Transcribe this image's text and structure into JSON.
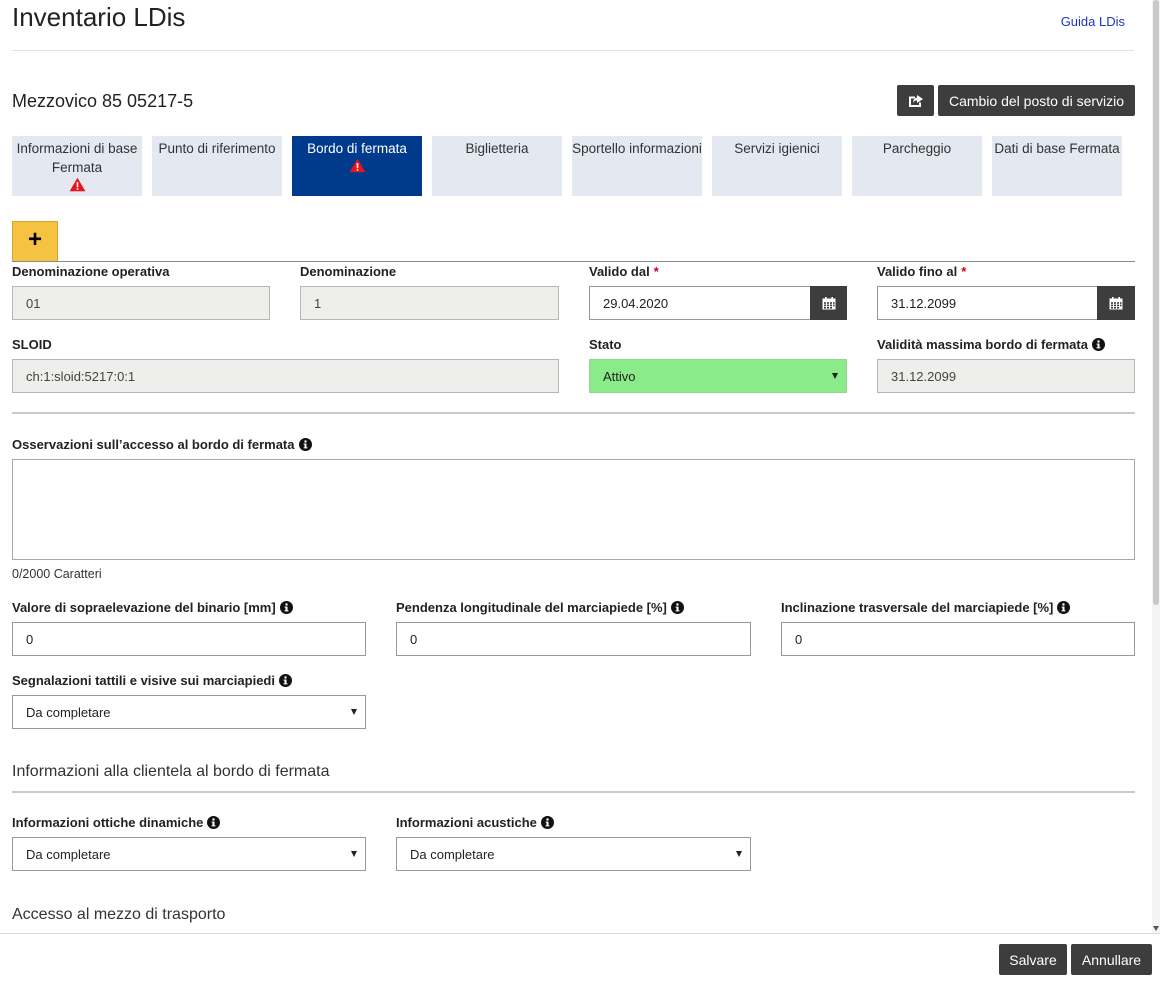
{
  "header": {
    "title": "Inventario LDis",
    "help_link": "Guida LDis"
  },
  "station": {
    "name": "Mezzovico 85 05217-5",
    "change_button": "Cambio del posto di servizio",
    "share_icon": "share-icon"
  },
  "tabs": [
    {
      "label": "Informazioni di base Fermata",
      "warning": true,
      "active": false
    },
    {
      "label": "Punto di riferimento",
      "warning": false,
      "active": false
    },
    {
      "label": "Bordo di fermata",
      "warning": true,
      "active": true
    },
    {
      "label": "Biglietteria",
      "warning": false,
      "active": false
    },
    {
      "label": "Sportello informazioni",
      "warning": false,
      "active": false
    },
    {
      "label": "Servizi igienici",
      "warning": false,
      "active": false
    },
    {
      "label": "Parcheggio",
      "warning": false,
      "active": false
    },
    {
      "label": "Dati di base Fermata",
      "warning": false,
      "active": false
    }
  ],
  "add_button": "+",
  "form": {
    "op_name": {
      "label": "Denominazione operativa",
      "value": "01"
    },
    "name": {
      "label": "Denominazione",
      "value": "1"
    },
    "valid_from": {
      "label": "Valido dal",
      "required_mark": "*",
      "value": "29.04.2020"
    },
    "valid_to": {
      "label": "Valido fino al",
      "required_mark": "*",
      "value": "31.12.2099"
    },
    "sloid": {
      "label": "SLOID",
      "value": "ch:1:sloid:5217:0:1"
    },
    "status": {
      "label": "Stato",
      "value": "Attivo"
    },
    "max_validity": {
      "label": "Validità massima bordo di fermata",
      "value": "31.12.2099"
    },
    "observations": {
      "label": "Osservazioni sull’accesso al bordo di fermata",
      "value": "",
      "counter": "0/2000 Caratteri"
    },
    "elevation": {
      "label": "Valore di sopraelevazione del binario [mm]",
      "value": "0"
    },
    "long_slope": {
      "label": "Pendenza longitudinale del marciapiede [%]",
      "value": "0"
    },
    "cross_slope": {
      "label": "Inclinazione trasversale del marciapiede [%]",
      "value": "0"
    },
    "tactile": {
      "label": "Segnalazioni tattili e visive sui marciapiedi",
      "value": "Da completare"
    }
  },
  "customer_info": {
    "heading": "Informazioni alla clientela al bordo di fermata",
    "optical": {
      "label": "Informazioni ottiche dinamiche",
      "value": "Da completare"
    },
    "acoustic": {
      "label": "Informazioni acustiche",
      "value": "Da completare"
    }
  },
  "access": {
    "heading": "Accesso al mezzo di trasporto"
  },
  "footer": {
    "save": "Salvare",
    "cancel": "Annullare"
  },
  "colors": {
    "active_tab": "#003a8c",
    "tab_bg": "#e3e8f1",
    "status_green": "#89ec89",
    "add_button": "#f5c242",
    "dark_button": "#3d3d3d"
  }
}
